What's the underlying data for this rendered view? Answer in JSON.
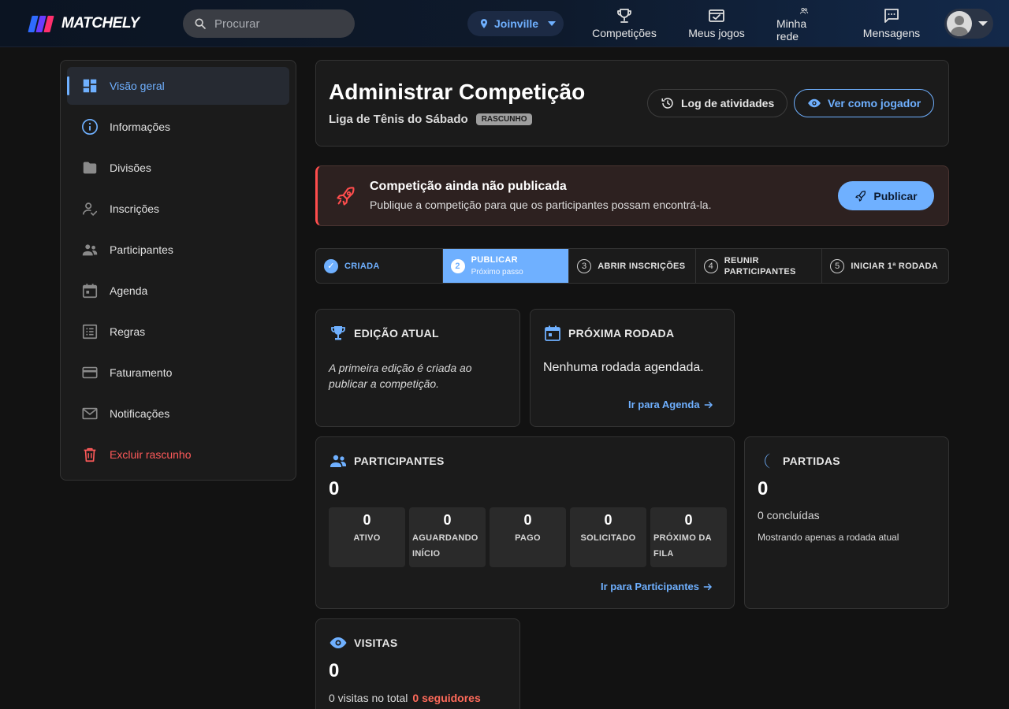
{
  "app": {
    "logo_text": "MATCHELY"
  },
  "search": {
    "placeholder": "Procurar"
  },
  "location": {
    "label": "Joinville"
  },
  "nav": {
    "competitions": "Competições",
    "my_games": "Meus jogos",
    "my_network": "Minha rede",
    "messages": "Mensagens"
  },
  "sidebar": {
    "items": [
      {
        "label": "Visão geral",
        "icon": "dashboard-icon"
      },
      {
        "label": "Informações",
        "icon": "info-icon"
      },
      {
        "label": "Divisões",
        "icon": "folder-icon"
      },
      {
        "label": "Inscrições",
        "icon": "user-check-icon"
      },
      {
        "label": "Participantes",
        "icon": "people-icon"
      },
      {
        "label": "Agenda",
        "icon": "calendar-icon"
      },
      {
        "label": "Regras",
        "icon": "list-icon"
      },
      {
        "label": "Faturamento",
        "icon": "credit-card-icon"
      },
      {
        "label": "Notificações",
        "icon": "mail-icon"
      },
      {
        "label": "Excluir rascunho",
        "icon": "trash-icon"
      }
    ]
  },
  "header": {
    "title": "Administrar Competição",
    "competition_name": "Liga de Tênis do Sábado",
    "status_badge": "RASCUNHO",
    "log_button": "Log de atividades",
    "view_as_player_button": "Ver como jogador"
  },
  "alert": {
    "title": "Competição ainda não publicada",
    "text": "Publique a competição para que os participantes possam encontrá-la.",
    "publish_button": "Publicar"
  },
  "steps": [
    {
      "num": "1",
      "label": "CRIADA",
      "sub": ""
    },
    {
      "num": "2",
      "label": "PUBLICAR",
      "sub": "Próximo passo"
    },
    {
      "num": "3",
      "label": "ABRIR INSCRIÇÕES",
      "sub": ""
    },
    {
      "num": "4",
      "label": "REUNIR PARTICIPANTES",
      "sub": ""
    },
    {
      "num": "5",
      "label": "INICIAR 1ª RODADA",
      "sub": ""
    }
  ],
  "edition": {
    "title": "EDIÇÃO ATUAL",
    "note": "A primeira edição é criada ao publicar a competição."
  },
  "next_round": {
    "title": "PRÓXIMA RODADA",
    "note": "Nenhuma rodada agendada.",
    "link": "Ir para Agenda"
  },
  "participants": {
    "title": "PARTICIPANTES",
    "total": "0",
    "stats": [
      {
        "value": "0",
        "label": "ATIVO"
      },
      {
        "value": "0",
        "label": "AGUARDANDO INÍCIO"
      },
      {
        "value": "0",
        "label": "PAGO"
      },
      {
        "value": "0",
        "label": "SOLICITADO"
      },
      {
        "value": "0",
        "label": "PRÓXIMO DA FILA"
      }
    ],
    "link": "Ir para Participantes"
  },
  "matches": {
    "title": "PARTIDAS",
    "total": "0",
    "completed": "0 concluídas",
    "note": "Mostrando apenas a rodada atual"
  },
  "visits": {
    "title": "VISITAS",
    "total": "0",
    "total_text": "0 visitas no total",
    "followers": "0 seguidores"
  },
  "colors": {
    "accent": "#6fb0ff",
    "danger": "#ff5a5a",
    "background": "#121212",
    "card": "#1b1b1b"
  }
}
